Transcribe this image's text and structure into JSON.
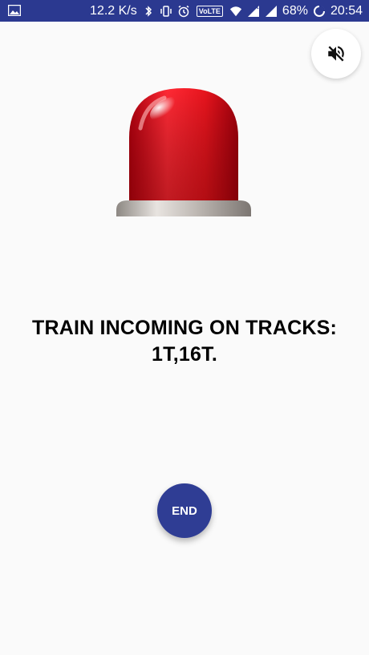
{
  "status_bar": {
    "net_speed": "12.2 K/s",
    "volte": "VoLTE",
    "battery": "68%",
    "time": "20:54"
  },
  "mute_button": {
    "icon": "volume-off-icon"
  },
  "siren": {
    "icon": "siren-icon"
  },
  "message": {
    "line1": "TRAIN INCOMING ON TRACKS:",
    "line2": "1T,16T."
  },
  "end_button": {
    "label": "END"
  },
  "colors": {
    "status_bar": "#2b3990",
    "end_button": "#2f3d94",
    "background": "#fafafa",
    "siren_red": "#e8141d"
  }
}
